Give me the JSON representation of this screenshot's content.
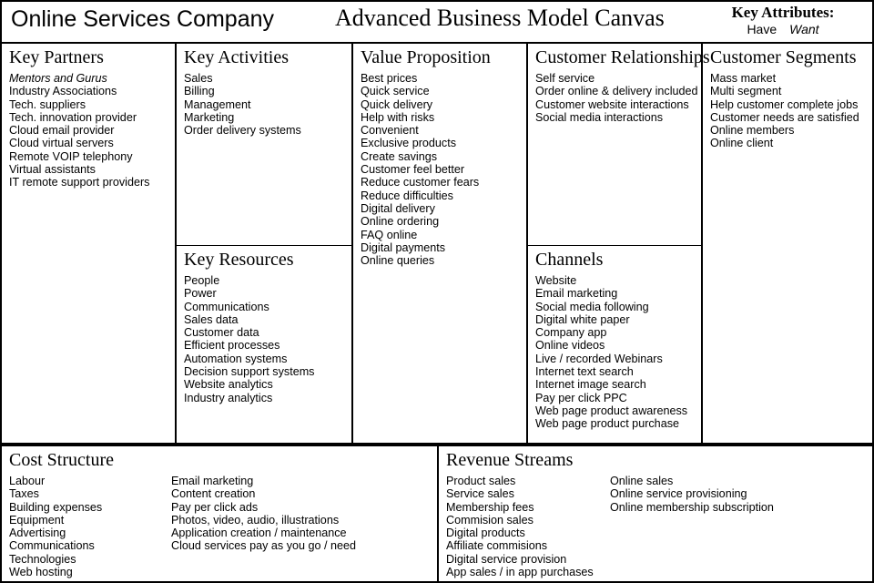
{
  "header": {
    "company_title": "Online Services Company",
    "canvas_title": "Advanced Business Model Canvas",
    "attributes_label": "Key Attributes:",
    "attribute_have": "Have",
    "attribute_want": "Want"
  },
  "blocks": {
    "key_partners": {
      "title": "Key Partners",
      "items": [
        {
          "text": "Mentors and Gurus",
          "attribute": "want"
        },
        {
          "text": "Industry Associations",
          "attribute": "have"
        },
        {
          "text": "Tech. suppliers",
          "attribute": "have"
        },
        {
          "text": "Tech. innovation provider",
          "attribute": "have"
        },
        {
          "text": "Cloud email provider",
          "attribute": "have"
        },
        {
          "text": "Cloud virtual servers",
          "attribute": "have"
        },
        {
          "text": "Remote VOIP telephony",
          "attribute": "have"
        },
        {
          "text": "Virtual assistants",
          "attribute": "have"
        },
        {
          "text": "IT remote support providers",
          "attribute": "have"
        }
      ]
    },
    "key_activities": {
      "title": "Key Activities",
      "items": [
        {
          "text": "Sales",
          "attribute": "have"
        },
        {
          "text": "Billing",
          "attribute": "have"
        },
        {
          "text": "Management",
          "attribute": "have"
        },
        {
          "text": "Marketing",
          "attribute": "have"
        },
        {
          "text": "Order delivery systems",
          "attribute": "have"
        }
      ]
    },
    "key_resources": {
      "title": "Key Resources",
      "items": [
        {
          "text": "People",
          "attribute": "have"
        },
        {
          "text": "Power",
          "attribute": "have"
        },
        {
          "text": "Communications",
          "attribute": "have"
        },
        {
          "text": "Sales data",
          "attribute": "have"
        },
        {
          "text": "Customer data",
          "attribute": "have"
        },
        {
          "text": "Efficient processes",
          "attribute": "have"
        },
        {
          "text": "Automation systems",
          "attribute": "have"
        },
        {
          "text": "Decision support systems",
          "attribute": "have"
        },
        {
          "text": "Website analytics",
          "attribute": "have"
        },
        {
          "text": "Industry analytics",
          "attribute": "have"
        }
      ]
    },
    "value_proposition": {
      "title": "Value Proposition",
      "items": [
        {
          "text": "Best prices",
          "attribute": "have"
        },
        {
          "text": "Quick service",
          "attribute": "have"
        },
        {
          "text": "Quick delivery",
          "attribute": "have"
        },
        {
          "text": "Help with risks",
          "attribute": "have"
        },
        {
          "text": "Convenient",
          "attribute": "have"
        },
        {
          "text": "Exclusive products",
          "attribute": "have"
        },
        {
          "text": "Create savings",
          "attribute": "have"
        },
        {
          "text": "Customer feel better",
          "attribute": "have"
        },
        {
          "text": "Reduce customer fears",
          "attribute": "have"
        },
        {
          "text": "Reduce difficulties",
          "attribute": "have"
        },
        {
          "text": "Digital delivery",
          "attribute": "have"
        },
        {
          "text": "Online ordering",
          "attribute": "have"
        },
        {
          "text": "FAQ online",
          "attribute": "have"
        },
        {
          "text": "Digital payments",
          "attribute": "have"
        },
        {
          "text": "Online queries",
          "attribute": "have"
        }
      ]
    },
    "customer_relationships": {
      "title": "Customer Relationships",
      "items": [
        {
          "text": "Self service",
          "attribute": "have"
        },
        {
          "text": "Order online & delivery included",
          "attribute": "have"
        },
        {
          "text": "Customer website interactions",
          "attribute": "have"
        },
        {
          "text": "Social media interactions",
          "attribute": "have"
        }
      ]
    },
    "channels": {
      "title": "Channels",
      "items": [
        {
          "text": "Website",
          "attribute": "have"
        },
        {
          "text": "Email marketing",
          "attribute": "have"
        },
        {
          "text": "Social media following",
          "attribute": "have"
        },
        {
          "text": "Digital white paper",
          "attribute": "have"
        },
        {
          "text": "Company app",
          "attribute": "have"
        },
        {
          "text": "Online videos",
          "attribute": "have"
        },
        {
          "text": "Live / recorded Webinars",
          "attribute": "have"
        },
        {
          "text": "Internet text search",
          "attribute": "have"
        },
        {
          "text": "Internet image search",
          "attribute": "have"
        },
        {
          "text": "Pay per click PPC",
          "attribute": "have"
        },
        {
          "text": "Web page product awareness",
          "attribute": "have"
        },
        {
          "text": "Web page product purchase",
          "attribute": "have"
        }
      ]
    },
    "customer_segments": {
      "title": "Customer Segments",
      "items": [
        {
          "text": "Mass market",
          "attribute": "have"
        },
        {
          "text": "Multi segment",
          "attribute": "have"
        },
        {
          "text": "Help customer complete jobs",
          "attribute": "have"
        },
        {
          "text": "Customer needs are satisfied",
          "attribute": "have"
        },
        {
          "text": "Online members",
          "attribute": "have"
        },
        {
          "text": "Online client",
          "attribute": "have"
        }
      ]
    },
    "cost_structure": {
      "title": "Cost Structure",
      "items": [
        {
          "text": "Labour",
          "attribute": "have"
        },
        {
          "text": "Taxes",
          "attribute": "have"
        },
        {
          "text": "Building expenses",
          "attribute": "have"
        },
        {
          "text": "Equipment",
          "attribute": "have"
        },
        {
          "text": "Advertising",
          "attribute": "have"
        },
        {
          "text": "Communications",
          "attribute": "have"
        },
        {
          "text": "Technologies",
          "attribute": "have"
        },
        {
          "text": "Web hosting",
          "attribute": "have"
        }
      ],
      "items_secondary": [
        {
          "text": "Email marketing",
          "attribute": "have"
        },
        {
          "text": "Content creation",
          "attribute": "have"
        },
        {
          "text": "Pay per click ads",
          "attribute": "have"
        },
        {
          "text": "Photos, video, audio, illustrations",
          "attribute": "have"
        },
        {
          "text": "Application creation / maintenance",
          "attribute": "have"
        },
        {
          "text": "Cloud services pay as you go / need",
          "attribute": "have"
        }
      ]
    },
    "revenue_streams": {
      "title": "Revenue Streams",
      "items": [
        {
          "text": "Product sales",
          "attribute": "have"
        },
        {
          "text": "Service sales",
          "attribute": "have"
        },
        {
          "text": "Membership fees",
          "attribute": "have"
        },
        {
          "text": "Commision sales",
          "attribute": "have"
        },
        {
          "text": "Digital products",
          "attribute": "have"
        },
        {
          "text": "Affiliate commisions",
          "attribute": "have"
        },
        {
          "text": "Digital service provision",
          "attribute": "have"
        },
        {
          "text": "App sales / in app purchases",
          "attribute": "have"
        }
      ],
      "items_secondary": [
        {
          "text": "Online sales",
          "attribute": "have"
        },
        {
          "text": "Online service provisioning",
          "attribute": "have"
        },
        {
          "text": "Online membership subscription",
          "attribute": "have"
        }
      ]
    }
  }
}
